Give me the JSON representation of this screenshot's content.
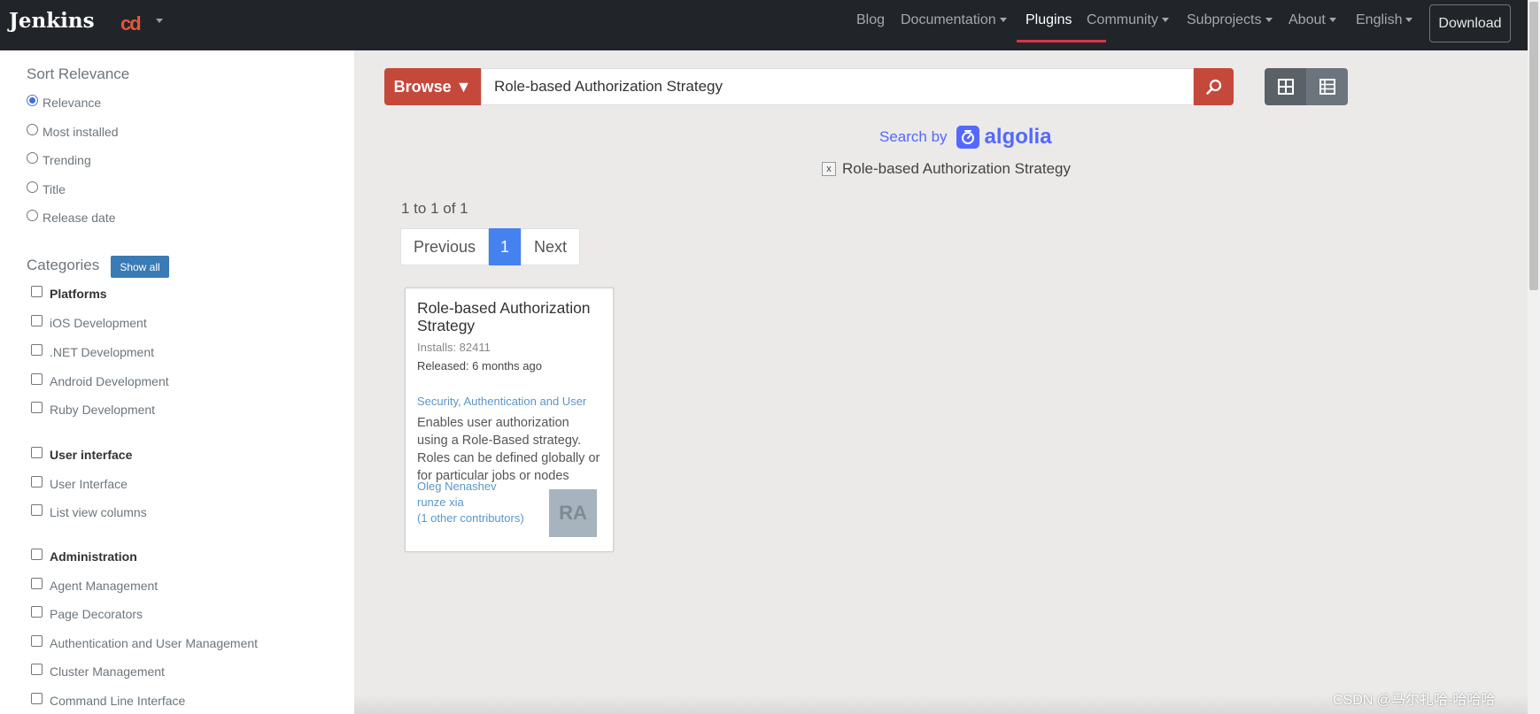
{
  "navbar": {
    "brand": "Jenkins",
    "cd_logo": "cd",
    "links": [
      {
        "label": "Blog",
        "has_caret": false,
        "active": false
      },
      {
        "label": "Documentation",
        "has_caret": true,
        "active": false
      },
      {
        "label": "Plugins",
        "has_caret": false,
        "active": true
      },
      {
        "label": "Community",
        "has_caret": true,
        "active": false
      },
      {
        "label": "Subprojects",
        "has_caret": true,
        "active": false
      },
      {
        "label": "About",
        "has_caret": true,
        "active": false
      },
      {
        "label": "English",
        "has_caret": true,
        "active": false
      }
    ],
    "download_label": "Download"
  },
  "sidebar": {
    "sort_heading": "Sort Relevance",
    "sort_options": [
      {
        "label": "Relevance",
        "checked": true
      },
      {
        "label": "Most installed",
        "checked": false
      },
      {
        "label": "Trending",
        "checked": false
      },
      {
        "label": "Title",
        "checked": false
      },
      {
        "label": "Release date",
        "checked": false
      }
    ],
    "categories_heading": "Categories",
    "show_all_label": "Show all",
    "category_groups": [
      {
        "label": "Platforms",
        "items": [
          "iOS Development",
          ".NET Development",
          "Android Development",
          "Ruby Development"
        ]
      },
      {
        "label": "User interface",
        "items": [
          "User Interface",
          "List view columns"
        ]
      },
      {
        "label": "Administration",
        "items": [
          "Agent Management",
          "Page Decorators",
          "Authentication and User Management",
          "Cluster Management",
          "Command Line Interface"
        ]
      }
    ]
  },
  "search": {
    "browse_label": "Browse ▼",
    "query": "Role-based Authorization Strategy",
    "search_by_label": "Search by",
    "algolia_label": "algolia",
    "active_filter": "Role-based Authorization Strategy",
    "filter_remove_label": "x"
  },
  "results": {
    "count_text": "1 to 1 of 1",
    "pager": {
      "previous": "Previous",
      "current": "1",
      "next": "Next"
    },
    "cards": [
      {
        "title": "Role-based Authorization Strategy",
        "installs": "Installs: 82411",
        "released": "Released: 6 months ago",
        "tags": "Security,  Authentication and User",
        "description": "Enables user authorization using a Role-Based strategy. Roles can be defined globally or for particular jobs or nodes",
        "authors": [
          "Oleg Nenashev",
          "runze xia",
          "(1 other contributors)"
        ],
        "avatar_initials": "RA"
      }
    ]
  },
  "watermark": "CSDN @马尔扎哈-哈哈哈",
  "colors": {
    "navbar_bg": "#212529",
    "accent_red": "#c4493b",
    "algolia_blue": "#5468ff",
    "pager_active": "#4582f0",
    "link_blue": "#5b96c8"
  }
}
